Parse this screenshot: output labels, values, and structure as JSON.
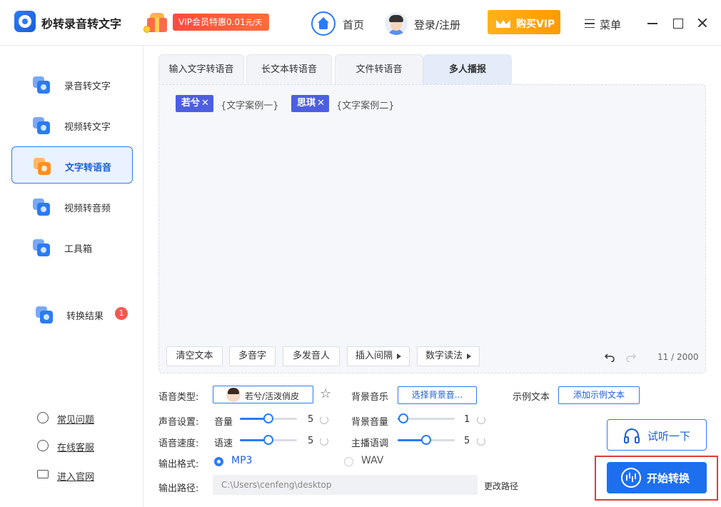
{
  "app": {
    "title": "秒转录音转文字",
    "promo_text": "VIP会员特惠0.01",
    "promo_unit": "元/天",
    "home_label": "首页",
    "login_label": "登录/注册",
    "buy_vip_label": "购买VIP",
    "menu_label": "菜单"
  },
  "sidebar": {
    "items": [
      {
        "label": "录音转文字",
        "icon": "mic-text-icon"
      },
      {
        "label": "视频转文字",
        "icon": "video-text-icon"
      },
      {
        "label": "文字转语音",
        "icon": "text-voice-icon",
        "active": true
      },
      {
        "label": "视频转音频",
        "icon": "video-audio-icon"
      },
      {
        "label": "工具箱",
        "icon": "toolbox-icon"
      },
      {
        "label": "转换结果",
        "icon": "result-icon",
        "badge": "1"
      }
    ],
    "help": [
      {
        "label": "常见问题",
        "icon": "question-icon"
      },
      {
        "label": "在线客服",
        "icon": "headset-icon"
      },
      {
        "label": "进入官网",
        "icon": "monitor-icon"
      }
    ]
  },
  "tabs": [
    {
      "label": "输入文字转语音"
    },
    {
      "label": "长文本转语音"
    },
    {
      "label": "文件转语音"
    },
    {
      "label": "多人播报",
      "active": true
    }
  ],
  "editor": {
    "voices": [
      {
        "name": "若兮",
        "text": "{文字案例一}"
      },
      {
        "name": "思琪",
        "text": "{文字案例二}"
      }
    ],
    "remove_symbol": "✕",
    "tools": [
      "清空文本",
      "多音字",
      "多发音人",
      "插入间隔",
      "数字读法"
    ],
    "char_count": "11 / 2000"
  },
  "settings": {
    "voice_type_label": "语音类型:",
    "voice_name": "若兮/活泼俏皮",
    "bgm_label": "背景音乐",
    "bgm_button": "选择背景音...",
    "example_label": "示例文本",
    "example_button": "添加示例文本",
    "sound_label": "声音设置:",
    "volume_label": "音量",
    "volume_value": 5,
    "bgm_volume_label": "背景音量",
    "bgm_volume_value": 1,
    "speed_label": "语音速度:",
    "rate_label": "语速",
    "rate_value": 5,
    "pitch_label": "主播语调",
    "pitch_value": 5,
    "slider_max": 10,
    "format_label": "输出格式:",
    "format_options": [
      "MP3",
      "WAV"
    ],
    "format_selected": "MP3",
    "path_label": "输出路径:",
    "path_value": "C:\\Users\\cenfeng\\desktop",
    "change_path": "更改路径",
    "preview_button": "试听一下",
    "convert_button": "开始转换"
  },
  "colors": {
    "accent": "#1e6fee",
    "chip": "#4d5fe0",
    "highlight": "#e03c3c",
    "badge": "#f05a4f"
  }
}
